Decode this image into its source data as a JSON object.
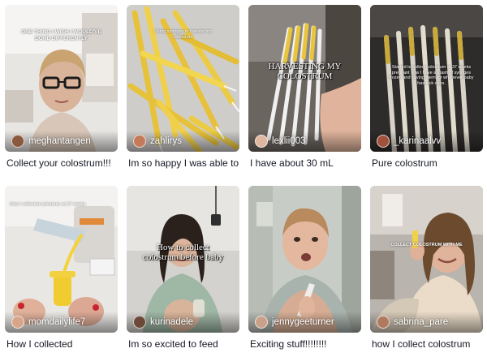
{
  "videos": [
    {
      "author": "meghantangen",
      "caption": "Collect your colostrum!!!",
      "overlay": "ONE THING I WISH I WOULD'VE DONE DIFFERENTLY",
      "avatar_color": "#8a5a3c"
    },
    {
      "author": "zahlirys",
      "caption": "Im so happy I was able to",
      "overlay": "Using syringes to harvest my colostrum",
      "avatar_color": "#c47a5a"
    },
    {
      "author": "lexlii003",
      "caption": "I have about 30 mL",
      "overlay": "HARVESTING MY COLOSTRUM",
      "avatar_color": "#e0b6a0"
    },
    {
      "author": "_karinaalvv",
      "caption": "Pure colostrum",
      "overlay": "Started to collect colostrum at 37 weeks pregnant now I have a stash of syringes frozen and saving them for whenever baby has sick days.",
      "avatar_color": "#a0523c"
    },
    {
      "author": "momdailylife7",
      "caption": "How I collected",
      "overlay": "How I collected colostrum at 37 weeks",
      "avatar_color": "#d9a58a"
    },
    {
      "author": "kurinadele",
      "caption": "Im so excited to feed",
      "overlay": "How to collect colostrum before baby",
      "avatar_color": "#6b4a3a"
    },
    {
      "author": "jennygeeturner",
      "caption": "Exciting stuff!!!!!!!!",
      "overlay": "",
      "avatar_color": "#c9a08a"
    },
    {
      "author": "sabrina_pare",
      "caption": "how I collect colostrum",
      "overlay": "COLLECT COLOSTRUM WITH ME",
      "avatar_color": "#b07a60"
    }
  ]
}
